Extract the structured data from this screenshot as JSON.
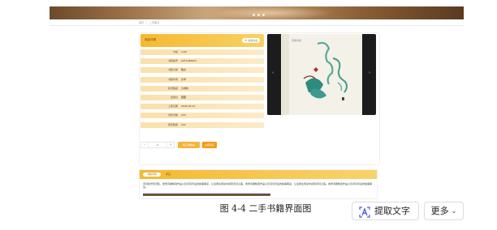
{
  "breadcrumb": {
    "items": [
      "首页",
      "二手图书"
    ]
  },
  "product": {
    "panel_title": "商品详情",
    "favorite_label": "收藏商品",
    "fields": [
      {
        "key": "价格",
        "value": "4.00"
      },
      {
        "key": "书籍编号",
        "value": "A2T1483001"
      },
      {
        "key": "书籍分类",
        "value": "散文"
      },
      {
        "key": "书籍作者",
        "value": "文学"
      },
      {
        "key": "新旧程度",
        "value": "九成新"
      },
      {
        "key": "出版社",
        "value": "国图"
      },
      {
        "key": "上架日期",
        "value": "2020-02-21"
      },
      {
        "key": "浏览次数",
        "value": "220"
      },
      {
        "key": "库存数量",
        "value": "222"
      }
    ],
    "quantity": "1",
    "qty_minus": "−",
    "qty_plus": "+",
    "add_to_cart_label": "加入购物车",
    "buy_now_label": "立即购买"
  },
  "book_cover": {
    "title_text": "四季诗香",
    "prev_icon": "chevron-left-icon",
    "next_icon": "chevron-right-icon"
  },
  "detail": {
    "active_tab": "书籍详情",
    "other_tab": "评论",
    "description": "诗词集作家诗集，收录诗歌精选作品以及诗词背后的故事解读，让读者在阅读中感受诗词之美。收录诗歌精选作品以及诗词背后的故事解读，让读者在阅读中感受诗词之美。收录诗歌精选作品以及诗词背后的故事解读。"
  },
  "caption": "图 4-4 二手书籍界面图",
  "toolbar": {
    "extract_label": "提取文字",
    "more_label": "更多"
  },
  "colors": {
    "accent": "#f5b931",
    "buy": "#f39c12"
  }
}
